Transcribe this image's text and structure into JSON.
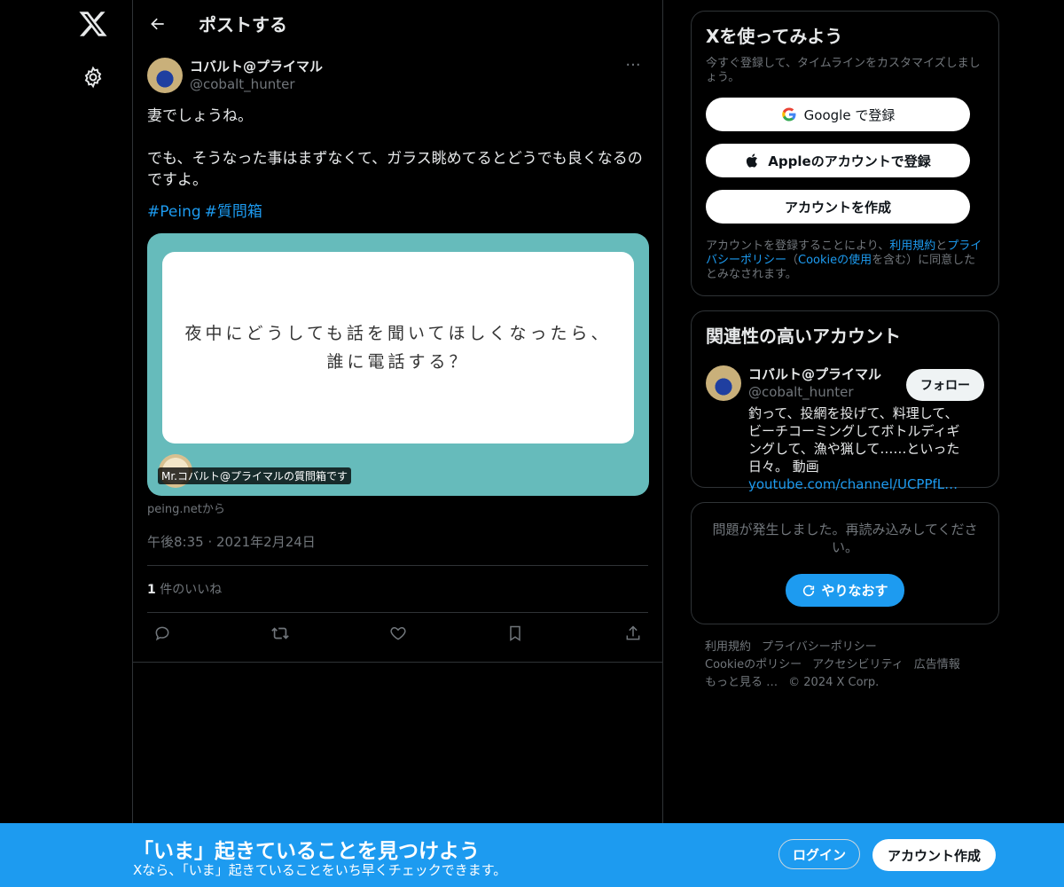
{
  "header": {
    "title": "ポストする"
  },
  "post": {
    "display_name": "コバルト@プライマル",
    "handle": "@cobalt_hunter",
    "text": "妻でしょうね。\n\nでも、そうなった事はまずなくて、ガラス眺めてるとどうでも良くなるのですよ。",
    "hashtags": [
      "#Peing",
      "#質問箱"
    ],
    "card": {
      "question_line1": "夜中にどうしても話を聞いてほしくなったら、",
      "question_line2": "誰に電話する？",
      "caption": "Mr.コバルト@プライマルの質問箱です"
    },
    "source": "peing.netから",
    "timestamp": "午後8:35 · 2021年2月24日",
    "likes_count": "1",
    "likes_label": " 件のいいね"
  },
  "signup": {
    "title": "Xを使ってみよう",
    "subtitle": "今すぐ登録して、タイムラインをカスタマイズしましょう。",
    "google": "Google で登録",
    "apple": "Appleのアカウントで登録",
    "create": "アカウントを作成",
    "terms_1": "アカウントを登録することにより、",
    "terms_link1": "利用規約",
    "terms_2": "と",
    "terms_link2": "プライバシーポリシー",
    "terms_3": "（",
    "terms_link3": "Cookieの使用",
    "terms_4": "を含む）に同意したとみなされます。"
  },
  "related": {
    "title": "関連性の高いアカウント",
    "name": "コバルト@プライマル",
    "handle": "@cobalt_hunter",
    "follow": "フォロー",
    "bio": "釣って、投網を投げて、料理して、ビーチコーミングしてボトルディギングして、漁や猟して……といった日々。 動画",
    "bio_link": "youtube.com/channel/UCPPfL…"
  },
  "error": {
    "message": "問題が発生しました。再読み込みしてください。",
    "retry": "やりなおす"
  },
  "footer": [
    "利用規約",
    "プライバシーポリシー",
    "Cookieのポリシー",
    "アクセシビリティ",
    "広告情報",
    "もっと見る …",
    "© 2024 X Corp."
  ],
  "banner": {
    "title": "「いま」起きていることを見つけよう",
    "subtitle": "Xなら、「いま」起きていることをいち早くチェックできます。",
    "login": "ログイン",
    "signup": "アカウント作成"
  },
  "colors": {
    "accent": "#1d9bf0",
    "background": "#000000",
    "card_bg": "#66bbbb"
  }
}
